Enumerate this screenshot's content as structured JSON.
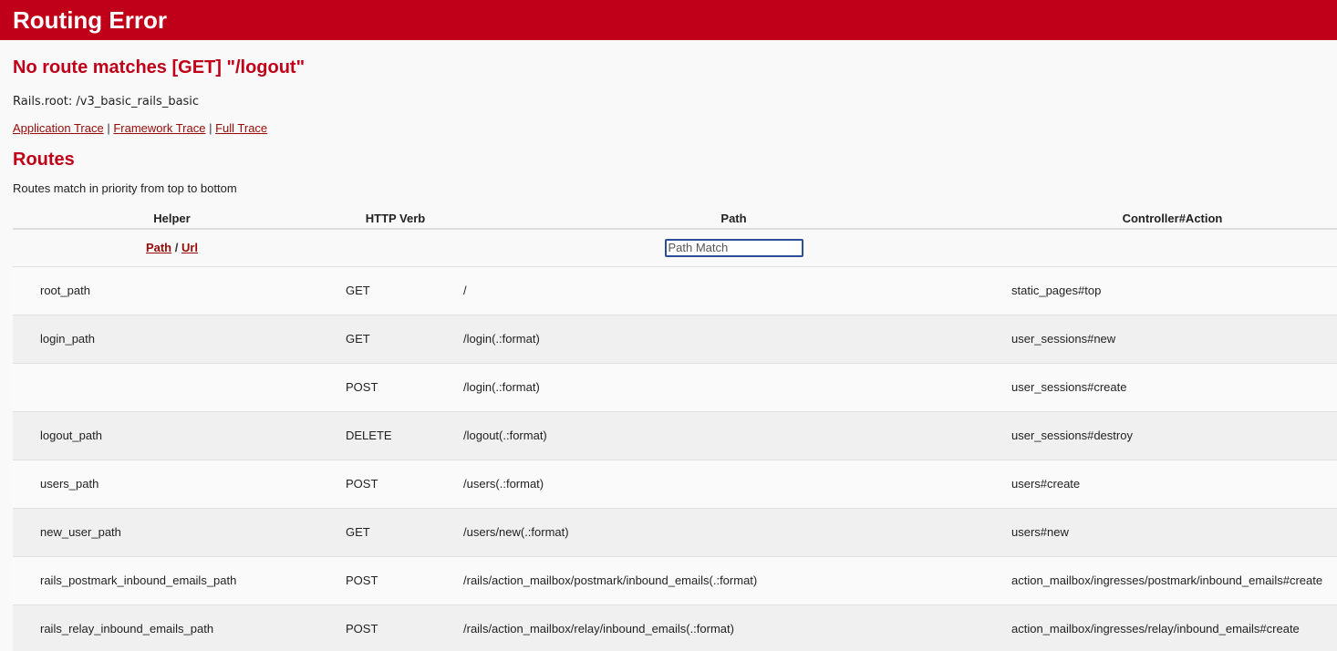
{
  "header": {
    "title": "Routing Error"
  },
  "error": {
    "message": "No route matches [GET] \"/logout\"",
    "rails_root": "Rails.root: /v3_basic_rails_basic"
  },
  "traces": {
    "application": "Application Trace",
    "framework": "Framework Trace",
    "full": "Full Trace",
    "separator": " | "
  },
  "routes": {
    "title": "Routes",
    "description": "Routes match in priority from top to bottom",
    "columns": {
      "helper": "Helper",
      "verb": "HTTP Verb",
      "path": "Path",
      "action": "Controller#Action"
    },
    "filter": {
      "path_link": "Path",
      "slash": " / ",
      "url_link": "Url",
      "placeholder": "Path Match"
    },
    "rows": [
      {
        "helper": "root_path",
        "verb": "GET",
        "path": "/",
        "action": "static_pages#top"
      },
      {
        "helper": "login_path",
        "verb": "GET",
        "path": "/login(.:format)",
        "action": "user_sessions#new"
      },
      {
        "helper": "",
        "verb": "POST",
        "path": "/login(.:format)",
        "action": "user_sessions#create"
      },
      {
        "helper": "logout_path",
        "verb": "DELETE",
        "path": "/logout(.:format)",
        "action": "user_sessions#destroy"
      },
      {
        "helper": "users_path",
        "verb": "POST",
        "path": "/users(.:format)",
        "action": "users#create"
      },
      {
        "helper": "new_user_path",
        "verb": "GET",
        "path": "/users/new(.:format)",
        "action": "users#new"
      },
      {
        "helper": "rails_postmark_inbound_emails_path",
        "verb": "POST",
        "path": "/rails/action_mailbox/postmark/inbound_emails(.:format)",
        "action": "action_mailbox/ingresses/postmark/inbound_emails#create"
      },
      {
        "helper": "rails_relay_inbound_emails_path",
        "verb": "POST",
        "path": "/rails/action_mailbox/relay/inbound_emails(.:format)",
        "action": "action_mailbox/ingresses/relay/inbound_emails#create"
      }
    ]
  }
}
